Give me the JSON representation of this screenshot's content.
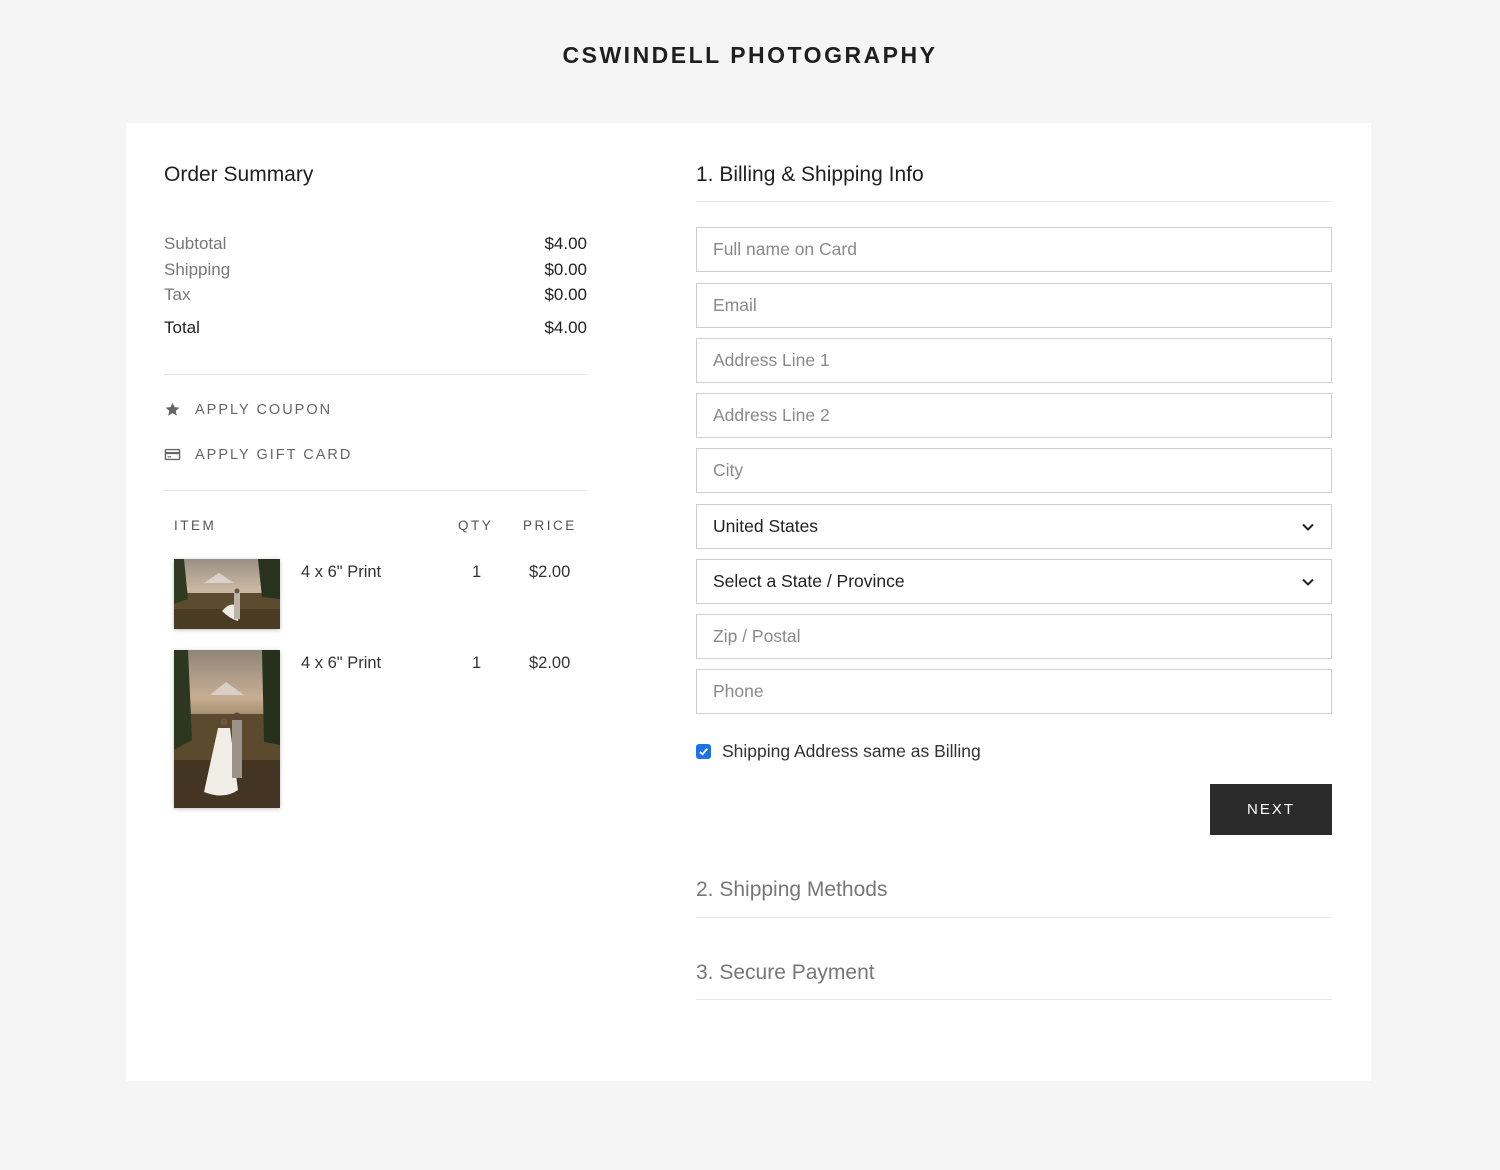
{
  "brand": "CSWINDELL PHOTOGRAPHY",
  "summary": {
    "title": "Order Summary",
    "rows": [
      {
        "label": "Subtotal",
        "value": "$4.00"
      },
      {
        "label": "Shipping",
        "value": "$0.00"
      },
      {
        "label": "Tax",
        "value": "$0.00"
      }
    ],
    "total": {
      "label": "Total",
      "value": "$4.00"
    },
    "coupon_label": "APPLY COUPON",
    "giftcard_label": "APPLY GIFT CARD",
    "columns": {
      "item": "ITEM",
      "qty": "QTY",
      "price": "PRICE"
    },
    "items": [
      {
        "name": "4 x 6\" Print",
        "qty": "1",
        "price": "$2.00"
      },
      {
        "name": "4 x 6\" Print",
        "qty": "1",
        "price": "$2.00"
      }
    ]
  },
  "billing": {
    "title": "1. Billing & Shipping Info",
    "placeholders": {
      "full_name": "Full name on Card",
      "email": "Email",
      "address1": "Address Line 1",
      "address2": "Address Line 2",
      "city": "City",
      "zip": "Zip / Postal",
      "phone": "Phone"
    },
    "country": "United States",
    "state": "Select a State / Province",
    "same_address_label": "Shipping Address same as Billing",
    "same_address_checked": true,
    "next_label": "NEXT"
  },
  "steps": {
    "shipping": "2. Shipping Methods",
    "payment": "3. Secure Payment"
  },
  "icons": {
    "coupon": "star-icon",
    "giftcard": "credit-card-icon",
    "select": "chevron-down-icon"
  },
  "colors": {
    "background": "#f5f5f5",
    "card": "#ffffff",
    "button": "#2b2b2b",
    "checkbox": "#1a73e8"
  }
}
